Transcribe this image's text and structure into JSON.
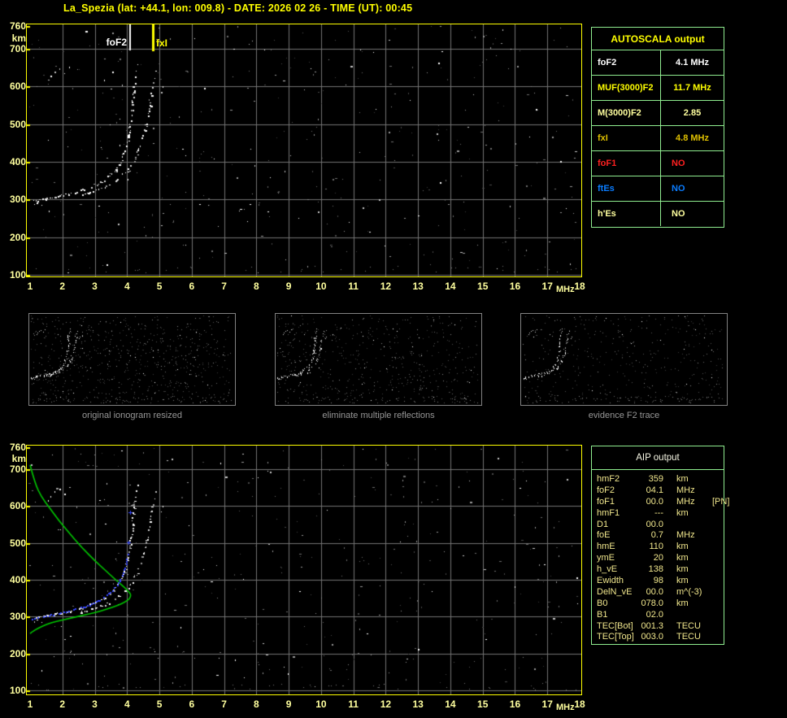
{
  "title": "La_Spezia (lat: +44.1, lon: 009.8) - DATE: 2026 02 26 - TIME (UT): 00:45",
  "colors": {
    "background": "#000000",
    "plot_border": "#ffff00",
    "axis_text": "#ffff9e",
    "grid": "#747474",
    "table_border": "#90ee90",
    "title_text": "#ffff00",
    "caption_text": "#969696",
    "profile_green": "#00c800",
    "restored_blue": "#3344ff"
  },
  "thumbnails": [
    {
      "caption": "original ionogram resized"
    },
    {
      "caption": "eliminate multiple reflections"
    },
    {
      "caption": "evidence F2 trace"
    }
  ],
  "autoscala_table": {
    "header": "AUTOSCALA output",
    "rows": [
      {
        "label": "foF2",
        "value": "4.1 MHz",
        "color": "#ffffff"
      },
      {
        "label": "MUF(3000)F2",
        "value": "11.7 MHz",
        "color": "#ffff00"
      },
      {
        "label": "M(3000)F2",
        "value": "2.85",
        "color": "#ffff9e"
      },
      {
        "label": "fxI",
        "value": "4.8 MHz",
        "color": "#dfc000"
      },
      {
        "label": "foF1",
        "value": "NO",
        "color": "#ff2020"
      },
      {
        "label": "ftEs",
        "value": "NO",
        "color": "#0a7cff"
      },
      {
        "label": "h'Es",
        "value": "NO",
        "color": "#ffff9e"
      }
    ]
  },
  "aip_table": {
    "header": "AIP output",
    "rows": [
      {
        "name": "hmF2",
        "value": "359",
        "unit": "km",
        "note": ""
      },
      {
        "name": "foF2",
        "value": "04.1",
        "unit": "MHz",
        "note": ""
      },
      {
        "name": "foF1",
        "value": "00.0",
        "unit": "MHz",
        "note": "[PN]"
      },
      {
        "name": "hmF1",
        "value": "---",
        "unit": "km",
        "note": ""
      },
      {
        "name": "D1",
        "value": "00.0",
        "unit": "",
        "note": ""
      },
      {
        "name": "foE",
        "value": "0.7",
        "unit": "MHz",
        "note": ""
      },
      {
        "name": "hmE",
        "value": "110",
        "unit": "km",
        "note": ""
      },
      {
        "name": "ymE",
        "value": "20",
        "unit": "km",
        "note": ""
      },
      {
        "name": "h_vE",
        "value": "138",
        "unit": "km",
        "note": ""
      },
      {
        "name": "Ewidth",
        "value": "98",
        "unit": "km",
        "note": ""
      },
      {
        "name": "DelN_vE",
        "value": "00.0",
        "unit": "m^(-3)",
        "note": ""
      },
      {
        "name": "B0",
        "value": "078.0",
        "unit": "km",
        "note": ""
      },
      {
        "name": "B1",
        "value": "02.0",
        "unit": "",
        "note": ""
      },
      {
        "name": "TEC[Bot]",
        "value": "001.3",
        "unit": "TECU",
        "note": ""
      },
      {
        "name": "TEC[Top]",
        "value": "003.0",
        "unit": "TECU",
        "note": ""
      }
    ]
  },
  "chart_data": {
    "type": "scatter",
    "xlabel": "MHz",
    "ylabel": "km",
    "xlim": [
      1,
      18
    ],
    "ylim": [
      100,
      760
    ],
    "x_ticks": [
      1,
      2,
      3,
      4,
      5,
      6,
      7,
      8,
      9,
      10,
      11,
      12,
      13,
      14,
      15,
      16,
      17,
      18
    ],
    "y_ticks": [
      760,
      700,
      600,
      500,
      400,
      300,
      200,
      100
    ],
    "top_plot_markers": [
      {
        "label": "foF2",
        "freq_mhz": 4.1,
        "color": "#ffffff"
      },
      {
        "label": "fxI",
        "freq_mhz": 4.8,
        "color": "#ffff00"
      }
    ],
    "o_trace_points_mhz_km": [
      [
        1.08,
        296
      ],
      [
        1.3,
        300
      ],
      [
        1.6,
        305
      ],
      [
        1.9,
        310
      ],
      [
        2.2,
        316
      ],
      [
        2.5,
        323
      ],
      [
        2.8,
        331
      ],
      [
        3.05,
        341
      ],
      [
        3.3,
        353
      ],
      [
        3.5,
        367
      ],
      [
        3.68,
        383
      ],
      [
        3.82,
        403
      ],
      [
        3.92,
        426
      ],
      [
        4.0,
        452
      ],
      [
        4.06,
        480
      ],
      [
        4.11,
        510
      ],
      [
        4.15,
        540
      ],
      [
        4.18,
        570
      ],
      [
        4.2,
        598
      ],
      [
        4.21,
        612
      ]
    ],
    "x_trace_points_mhz_km": [
      [
        2.55,
        312
      ],
      [
        2.8,
        318
      ],
      [
        3.05,
        325
      ],
      [
        3.3,
        334
      ],
      [
        3.55,
        345
      ],
      [
        3.78,
        359
      ],
      [
        3.98,
        376
      ],
      [
        4.15,
        396
      ],
      [
        4.3,
        420
      ],
      [
        4.42,
        447
      ],
      [
        4.52,
        477
      ],
      [
        4.6,
        508
      ],
      [
        4.67,
        540
      ],
      [
        4.72,
        570
      ],
      [
        4.76,
        595
      ],
      [
        4.78,
        610
      ]
    ],
    "sparse_echo_points_mhz_km": [
      [
        4.24,
        626
      ],
      [
        4.28,
        642
      ],
      [
        4.33,
        658
      ],
      [
        4.84,
        622
      ],
      [
        4.88,
        641
      ],
      [
        5.05,
        585
      ],
      [
        5.1,
        600
      ],
      [
        1.62,
        628
      ],
      [
        1.75,
        640
      ],
      [
        1.9,
        648
      ],
      [
        2.05,
        634
      ],
      [
        2.2,
        652
      ],
      [
        1.55,
        617
      ],
      [
        3.3,
        618
      ],
      [
        1.12,
        288
      ],
      [
        1.2,
        293
      ],
      [
        1.35,
        286
      ]
    ],
    "bottom_plot": {
      "profile_curve_mhz_km": [
        [
          1.0,
          712
        ],
        [
          1.15,
          662
        ],
        [
          1.35,
          625
        ],
        [
          1.6,
          596
        ],
        [
          1.9,
          560
        ],
        [
          2.2,
          528
        ],
        [
          2.6,
          488
        ],
        [
          3.0,
          452
        ],
        [
          3.4,
          420
        ],
        [
          3.7,
          396
        ],
        [
          3.95,
          377
        ],
        [
          4.08,
          365
        ],
        [
          4.12,
          359
        ],
        [
          4.08,
          349
        ],
        [
          3.95,
          340
        ],
        [
          3.7,
          330
        ],
        [
          3.4,
          321
        ],
        [
          3.0,
          311
        ],
        [
          2.6,
          303
        ],
        [
          2.2,
          295
        ],
        [
          1.8,
          287
        ],
        [
          1.5,
          279
        ],
        [
          1.25,
          269
        ],
        [
          1.05,
          258
        ],
        [
          1.0,
          254
        ]
      ],
      "restored_trace_mhz_km": [
        [
          1.02,
          291
        ],
        [
          1.3,
          297
        ],
        [
          1.6,
          302
        ],
        [
          1.9,
          308
        ],
        [
          2.2,
          314
        ],
        [
          2.5,
          321
        ],
        [
          2.8,
          329
        ],
        [
          3.05,
          339
        ],
        [
          3.3,
          351
        ],
        [
          3.5,
          365
        ],
        [
          3.68,
          381
        ],
        [
          3.82,
          401
        ],
        [
          3.92,
          424
        ],
        [
          4.0,
          450
        ],
        [
          4.05,
          475
        ]
      ],
      "restored_isolated_points_mhz_km": [
        [
          4.04,
          502
        ],
        [
          4.09,
          583
        ]
      ]
    }
  }
}
